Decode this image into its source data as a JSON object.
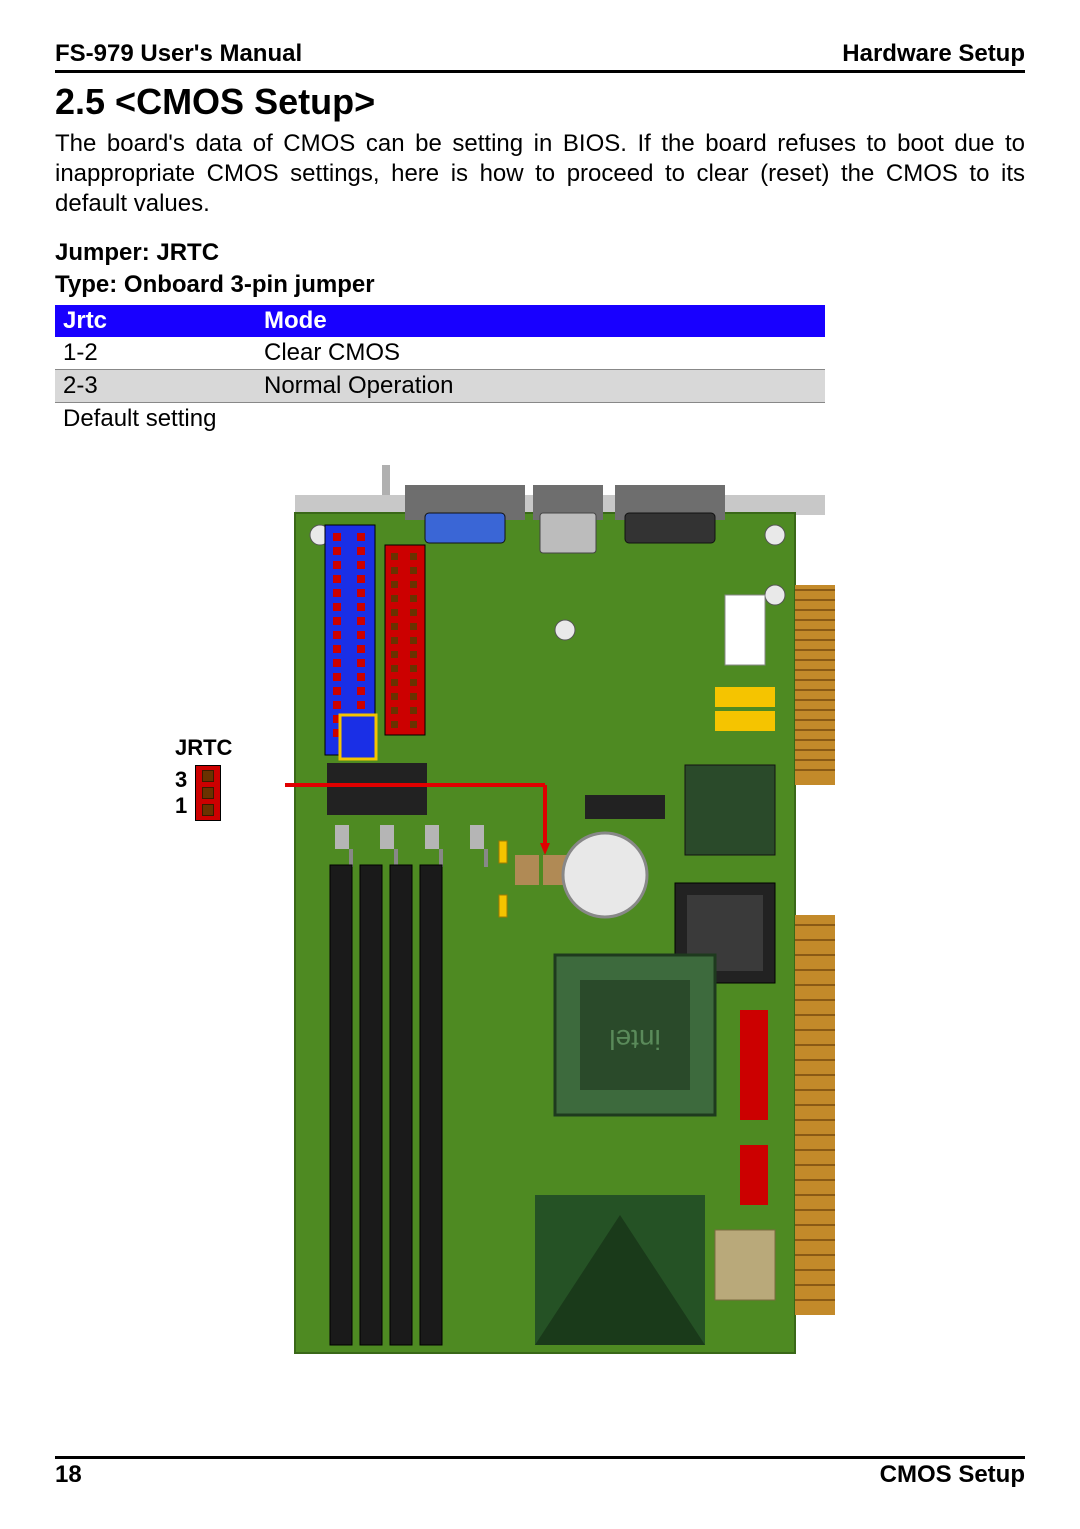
{
  "header": {
    "left": "FS-979 User's Manual",
    "right": "Hardware Setup"
  },
  "section_title": "2.5 <CMOS Setup>",
  "body_text": "The board's data of CMOS can be setting in BIOS. If the board refuses to boot due to inappropriate CMOS settings, here is how to proceed to clear (reset) the CMOS to its default values.",
  "jumper_label": "Jumper: JRTC",
  "type_label": "Type: Onboard 3-pin jumper",
  "table": {
    "headers": [
      "Jrtc",
      "Mode"
    ],
    "rows": [
      {
        "jrtc": "1-2",
        "mode": "Clear CMOS",
        "alt": false
      },
      {
        "jrtc": "2-3",
        "mode": "Normal Operation",
        "alt": true
      }
    ]
  },
  "default_setting": "Default setting",
  "callout": {
    "title": "JRTC",
    "pin3": "3",
    "pin1": "1"
  },
  "footer": {
    "left": "18",
    "right": "CMOS  Setup"
  },
  "board": {
    "cpu_text": "intel"
  }
}
